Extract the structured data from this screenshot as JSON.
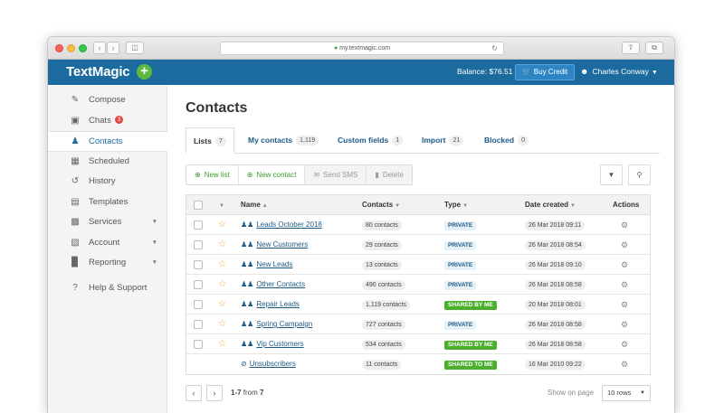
{
  "browser": {
    "url": "my.textmagic.com"
  },
  "topbar": {
    "logo": "TextMagic",
    "balance": "Balance: $76.51",
    "buy_credit": "Buy Credit",
    "user_name": "Charles Conway"
  },
  "sidebar": {
    "items": [
      {
        "label": "Compose",
        "icon": "compose-icon"
      },
      {
        "label": "Chats",
        "badge": "3",
        "icon": "chat-icon"
      },
      {
        "label": "Contacts",
        "icon": "contacts-icon"
      },
      {
        "label": "Scheduled",
        "icon": "calendar-icon"
      },
      {
        "label": "History",
        "icon": "history-icon"
      },
      {
        "label": "Templates",
        "icon": "templates-icon"
      },
      {
        "label": "Services",
        "icon": "services-icon"
      },
      {
        "label": "Account",
        "icon": "account-icon"
      },
      {
        "label": "Reporting",
        "icon": "reporting-icon"
      },
      {
        "label": "Help & Support",
        "icon": "help-icon"
      }
    ]
  },
  "page": {
    "title": "Contacts"
  },
  "tabs": [
    {
      "label": "Lists",
      "count": "7"
    },
    {
      "label": "My contacts",
      "count": "1,119"
    },
    {
      "label": "Custom fields",
      "count": "1"
    },
    {
      "label": "Import",
      "count": "21"
    },
    {
      "label": "Blocked",
      "count": "0"
    }
  ],
  "toolbar": {
    "new_list": "New list",
    "new_contact": "New contact",
    "send_sms": "Send SMS",
    "delete": "Delete"
  },
  "table": {
    "headers": {
      "name": "Name",
      "contacts": "Contacts",
      "type": "Type",
      "date_created": "Date created",
      "actions": "Actions"
    },
    "rows": [
      {
        "name": "Leads October 2018",
        "contacts": "80 contacts",
        "type": "PRIVATE",
        "date": "26 Mar 2018 09:11"
      },
      {
        "name": "New Customers",
        "contacts": "29 contacts",
        "type": "PRIVATE",
        "date": "26 Mar 2018 08:54"
      },
      {
        "name": "New Leads",
        "contacts": "13 contacts",
        "type": "PRIVATE",
        "date": "26 Mar 2018 09:10"
      },
      {
        "name": "Other Contacts",
        "contacts": "490 contacts",
        "type": "PRIVATE",
        "date": "26 Mar 2018 08:58"
      },
      {
        "name": "Repair Leads",
        "contacts": "1,119 contacts",
        "type": "SHARED BY ME",
        "date": "20 Mar 2018 08:01"
      },
      {
        "name": "Spring Campaign",
        "contacts": "727 contacts",
        "type": "PRIVATE",
        "date": "26 Mar 2018 08:58"
      },
      {
        "name": "Vip Customers",
        "contacts": "534 contacts",
        "type": "SHARED BY ME",
        "date": "26 Mar 2018 08:58"
      },
      {
        "name": "Unsubscribers",
        "contacts": "11 contacts",
        "type": "SHARED TO ME",
        "date": "16 Mar 2010 09:22"
      }
    ]
  },
  "pager": {
    "range": "1-7",
    "from_label": "from",
    "total": "7",
    "show_on_page": "Show on page",
    "rows_option": "10 rows"
  }
}
